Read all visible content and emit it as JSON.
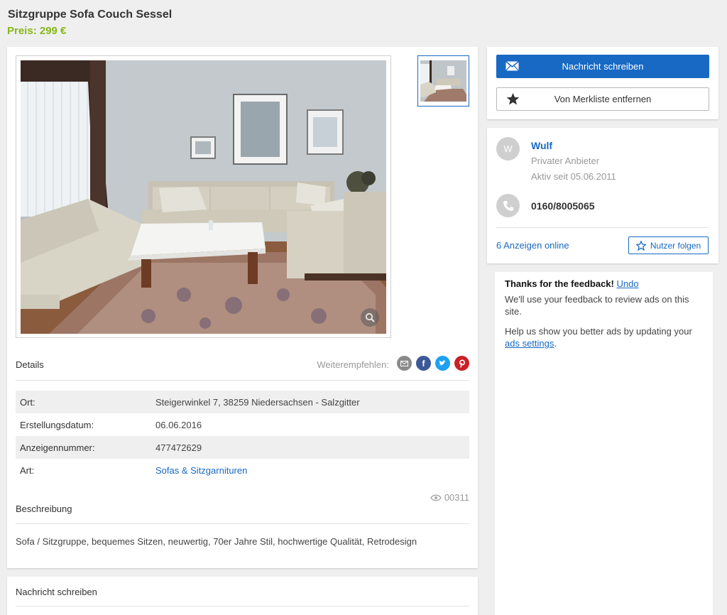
{
  "listing": {
    "title": "Sitzgruppe Sofa Couch Sessel",
    "price": "Preis: 299 €"
  },
  "details": {
    "heading": "Details",
    "share_label": "Weiterempfehlen:",
    "rows": [
      {
        "key": "Ort:",
        "value": "Steigerwinkel 7, 38259 Niedersachsen - Salzgitter"
      },
      {
        "key": "Erstellungsdatum:",
        "value": "06.06.2016"
      },
      {
        "key": "Anzeigennummer:",
        "value": "477472629"
      },
      {
        "key": "Art:",
        "value": "Sofas & Sitzgarnituren"
      }
    ],
    "views": "00311"
  },
  "description": {
    "heading": "Beschreibung",
    "text": "Sofa / Sitzgruppe, bequemes Sitzen, neuwertig, 70er Jahre Stil, hochwertige Qualität, Retrodesign"
  },
  "message_section": {
    "heading": "Nachricht schreiben"
  },
  "actions": {
    "message_button": "Nachricht schreiben",
    "watchlist_button": "Von Merkliste entfernen"
  },
  "seller": {
    "initial": "W",
    "name": "Wulf",
    "type": "Privater Anbieter",
    "active_since": "Aktiv seit 05.06.2011",
    "phone": "0160/8005065",
    "ads_online": "6 Anzeigen online",
    "follow_button": "Nutzer folgen"
  },
  "ad_feedback": {
    "thanks": "Thanks for the feedback!",
    "undo": "Undo",
    "line2": "We'll use your feedback to review ads on this site.",
    "line3_prefix": "Help us show you better ads by updating your",
    "settings_link": "ads settings",
    "line3_suffix": "."
  },
  "colors": {
    "brand_blue": "#1769c4",
    "price_green": "#86b817"
  },
  "icons": {
    "message": "envelope-icon",
    "watchlist": "star-icon",
    "phone": "phone-icon",
    "views": "eye-icon",
    "zoom": "magnifier-icon",
    "share": [
      "email-share-icon",
      "facebook-icon",
      "twitter-icon",
      "pinterest-icon"
    ]
  }
}
